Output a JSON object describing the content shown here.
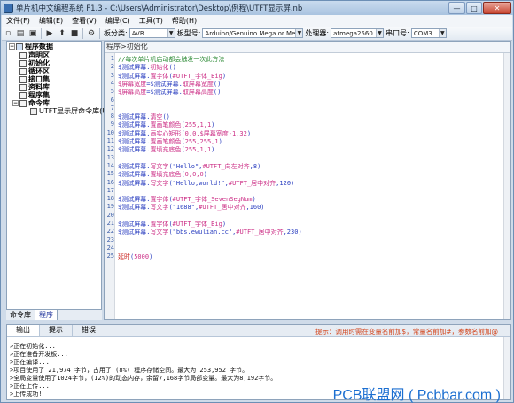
{
  "titlebar": {
    "title": "单片机中文编程系统 F1.3 - C:\\Users\\Administrator\\Desktop\\例程\\UTFT显示屏.nb",
    "minimize": "—",
    "maximize": "□",
    "close": "✕"
  },
  "menubar": [
    "文件(F)",
    "编辑(E)",
    "查看(V)",
    "编译(C)",
    "工具(T)",
    "帮助(H)"
  ],
  "toolbar": {
    "board_label": "板分类:",
    "board_value": "AVR",
    "model_label": "板型号:",
    "model_value": "Arduino/Genuino Mega or Mega 25",
    "processor_label": "处理器:",
    "processor_value": "atmega2560",
    "port_label": "串口号:",
    "port_value": "COM3"
  },
  "tree": {
    "root": "程序数据",
    "items": [
      "声明区",
      "初始化",
      "循环区",
      "接口集",
      "资料库",
      "程序集",
      "命令库"
    ],
    "subitem": "UTFT显示屏命令库(U"
  },
  "left_tabs": [
    "命令库",
    "程序"
  ],
  "editor": {
    "tab": "程序>初始化",
    "lines": [
      [
        {
          "c": "c-cm",
          "t": "//每次单片机启动都会触发一次此方法"
        }
      ],
      [
        {
          "c": "c-ob",
          "t": "$测试屏幕."
        },
        {
          "c": "c-pk",
          "t": "初始化"
        },
        {
          "c": "c-ob",
          "t": "()"
        }
      ],
      [
        {
          "c": "c-ob",
          "t": "$测试屏幕."
        },
        {
          "c": "c-pk",
          "t": "置字体"
        },
        {
          "c": "c-ob",
          "t": "("
        },
        {
          "c": "c-pk",
          "t": "#UTFT_字体_Big"
        },
        {
          "c": "c-ob",
          "t": ")"
        }
      ],
      [
        {
          "c": "c-pk",
          "t": "$屏幕宽度"
        },
        {
          "c": "c-ob",
          "t": "=$测试屏幕."
        },
        {
          "c": "c-pk",
          "t": "取屏幕宽度"
        },
        {
          "c": "c-ob",
          "t": "()"
        }
      ],
      [
        {
          "c": "c-pk",
          "t": "$屏幕高度"
        },
        {
          "c": "c-ob",
          "t": "=$测试屏幕."
        },
        {
          "c": "c-pk",
          "t": "取屏幕高度"
        },
        {
          "c": "c-ob",
          "t": "()"
        }
      ],
      [],
      [],
      [
        {
          "c": "c-ob",
          "t": "$测试屏幕."
        },
        {
          "c": "c-pk",
          "t": "清空"
        },
        {
          "c": "c-ob",
          "t": "()"
        }
      ],
      [
        {
          "c": "c-ob",
          "t": "$测试屏幕."
        },
        {
          "c": "c-pk",
          "t": "置画笔颜色"
        },
        {
          "c": "c-ob",
          "t": "("
        },
        {
          "c": "c-pk",
          "t": "255,1,1"
        },
        {
          "c": "c-ob",
          "t": ")"
        }
      ],
      [
        {
          "c": "c-ob",
          "t": "$测试屏幕."
        },
        {
          "c": "c-pk",
          "t": "画实心矩形"
        },
        {
          "c": "c-ob",
          "t": "("
        },
        {
          "c": "c-pk",
          "t": "0,0,$屏幕宽度-1,32"
        },
        {
          "c": "c-ob",
          "t": ")"
        }
      ],
      [
        {
          "c": "c-ob",
          "t": "$测试屏幕."
        },
        {
          "c": "c-pk",
          "t": "置画笔颜色"
        },
        {
          "c": "c-ob",
          "t": "("
        },
        {
          "c": "c-pk",
          "t": "255,255,1"
        },
        {
          "c": "c-ob",
          "t": ")"
        }
      ],
      [
        {
          "c": "c-ob",
          "t": "$测试屏幕."
        },
        {
          "c": "c-pk",
          "t": "置填充底色"
        },
        {
          "c": "c-ob",
          "t": "("
        },
        {
          "c": "c-pk",
          "t": "255,1,1"
        },
        {
          "c": "c-ob",
          "t": ")"
        }
      ],
      [],
      [
        {
          "c": "c-ob",
          "t": "$测试屏幕."
        },
        {
          "c": "c-pk",
          "t": "写文字"
        },
        {
          "c": "c-ob",
          "t": "(\"Hello\","
        },
        {
          "c": "c-pk",
          "t": "#UTFT_向左对齐"
        },
        {
          "c": "c-ob",
          "t": ",8)"
        }
      ],
      [
        {
          "c": "c-ob",
          "t": "$测试屏幕."
        },
        {
          "c": "c-pk",
          "t": "置填充底色"
        },
        {
          "c": "c-ob",
          "t": "("
        },
        {
          "c": "c-pk",
          "t": "0,0,0"
        },
        {
          "c": "c-ob",
          "t": ")"
        }
      ],
      [
        {
          "c": "c-ob",
          "t": "$测试屏幕."
        },
        {
          "c": "c-pk",
          "t": "写文字"
        },
        {
          "c": "c-ob",
          "t": "(\"Hello,world!\","
        },
        {
          "c": "c-pk",
          "t": "#UTFT_居中对齐"
        },
        {
          "c": "c-ob",
          "t": ",120)"
        }
      ],
      [],
      [
        {
          "c": "c-ob",
          "t": "$测试屏幕."
        },
        {
          "c": "c-pk",
          "t": "置字体"
        },
        {
          "c": "c-ob",
          "t": "("
        },
        {
          "c": "c-pk",
          "t": "#UTFT_字体_SevenSegNum"
        },
        {
          "c": "c-ob",
          "t": ")"
        }
      ],
      [
        {
          "c": "c-ob",
          "t": "$测试屏幕."
        },
        {
          "c": "c-pk",
          "t": "写文字"
        },
        {
          "c": "c-ob",
          "t": "(\"1688\","
        },
        {
          "c": "c-pk",
          "t": "#UTFT_居中对齐"
        },
        {
          "c": "c-ob",
          "t": ",160)"
        }
      ],
      [],
      [
        {
          "c": "c-ob",
          "t": "$测试屏幕."
        },
        {
          "c": "c-pk",
          "t": "置字体"
        },
        {
          "c": "c-ob",
          "t": "("
        },
        {
          "c": "c-pk",
          "t": "#UTFT_字体_Big"
        },
        {
          "c": "c-ob",
          "t": ")"
        }
      ],
      [
        {
          "c": "c-ob",
          "t": "$测试屏幕."
        },
        {
          "c": "c-pk",
          "t": "写文字"
        },
        {
          "c": "c-ob",
          "t": "(\"bbs.ewulian.cc\","
        },
        {
          "c": "c-pk",
          "t": "#UTFT_居中对齐"
        },
        {
          "c": "c-ob",
          "t": ",230)"
        }
      ],
      [],
      [],
      [
        {
          "c": "c-rd",
          "t": "延时"
        },
        {
          "c": "c-ob",
          "t": "("
        },
        {
          "c": "c-pk",
          "t": "5000"
        },
        {
          "c": "c-ob",
          "t": ")"
        }
      ]
    ]
  },
  "bottom": {
    "tabs": [
      "输出",
      "提示",
      "错误"
    ],
    "hint": "提示：调用时需在变量名前加$，常量名前加#，参数名前加@",
    "lines": [
      ">正在初始化...",
      ">正在准备开发板...",
      ">正在编译...",
      ">项目使用了 21,974 字节，占用了 (8%) 程序存储空间。最大为 253,952 字节。",
      ">全局变量使用了1024字节，(12%)的动态内存，余留7,168字节局部变量。最大为8,192字节。",
      ">正在上传...",
      ">上传成功!"
    ]
  },
  "watermark": "PCB联盟网 ( Pcbbar.com )"
}
